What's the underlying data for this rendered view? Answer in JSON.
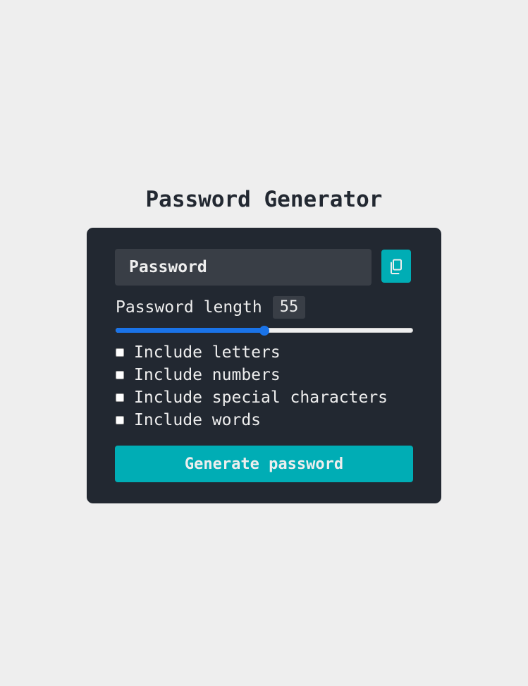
{
  "page": {
    "title": "Password Generator"
  },
  "password": {
    "value": "",
    "placeholder": "Password"
  },
  "copy_button": {
    "icon": "copy-icon"
  },
  "length": {
    "label": "Password length",
    "value": "55",
    "fraction": 0.5
  },
  "options": [
    {
      "label": "Include letters",
      "checked": false
    },
    {
      "label": "Include numbers",
      "checked": false
    },
    {
      "label": "Include special characters",
      "checked": false
    },
    {
      "label": "Include words",
      "checked": false
    }
  ],
  "generate_button": {
    "label": "Generate password"
  },
  "colors": {
    "page_bg": "#eeeeee",
    "card_bg": "#222831",
    "field_bg": "#393e46",
    "accent": "#00adb5",
    "slider_fill": "#1a73e8",
    "text_light": "#eeeeee",
    "text_dark": "#222831"
  }
}
